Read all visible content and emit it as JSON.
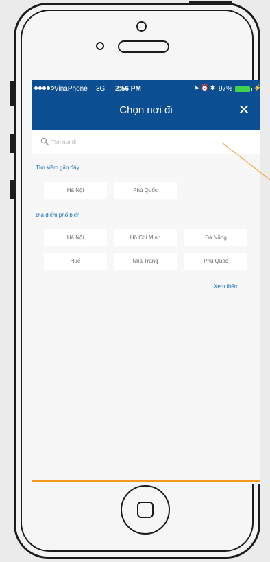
{
  "status_bar": {
    "carrier": "VinaPhone",
    "network": "3G",
    "time": "2:56 PM",
    "battery": "97%"
  },
  "header": {
    "title": "Chọn nơi đi"
  },
  "search": {
    "placeholder": "Tìm nơi đi"
  },
  "recent": {
    "label": "Tìm kiếm gần đây",
    "items": [
      "Hà Nội",
      "Phú Quốc"
    ]
  },
  "popular": {
    "label": "Địa điểm phổ biến",
    "items": [
      "Hà Nội",
      "Hồ Chí Minh",
      "Đà Nẵng",
      "Huế",
      "Nha Trang",
      "Phú Quốc"
    ]
  },
  "see_more": "Xem thêm",
  "colors": {
    "header": "#0b4f92",
    "accent": "#1a6fbd",
    "annotation": "#f39a1e",
    "battery": "#3fd24c"
  }
}
